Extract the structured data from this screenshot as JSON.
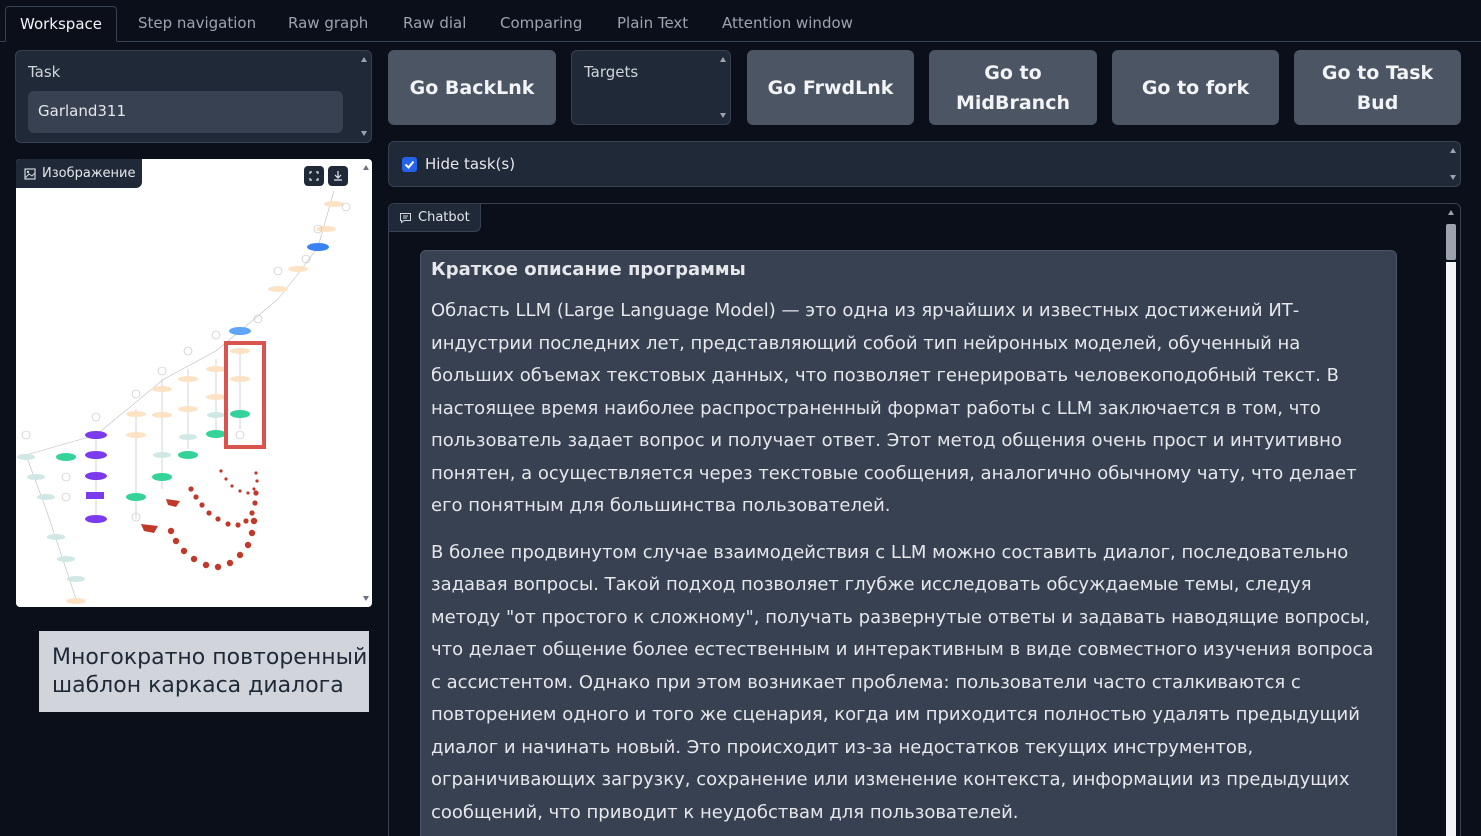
{
  "tabs": [
    "Workspace",
    "Step navigation",
    "Raw graph",
    "Raw dial",
    "Comparing",
    "Plain Text",
    "Attention window"
  ],
  "task": {
    "label": "Task",
    "value": "Garland311"
  },
  "image_panel": {
    "label": "Изображение"
  },
  "buttons": {
    "back": "Go BackLnk",
    "forward": "Go FrwdLnk",
    "midbranch": "Go to MidBranch",
    "fork": "Go to fork",
    "task_bud": "Go to Task Bud"
  },
  "targets": {
    "label": "Targets"
  },
  "hide_tasks": {
    "label": "Hide task(s)",
    "checked": true
  },
  "chatbot": {
    "label": "Chatbot",
    "heading": "Краткое описание программы",
    "paragraphs": [
      "Область LLM (Large Language Model) — это одна из ярчайших и известных достижений ИТ-индустрии последних лет, представляющий собой тип нейронных моделей, обученный на больших объемах текстовых данных, что позволяет генерировать человекоподобный текст. В настоящее время наиболее распространенный формат работы с LLM заключается в том, что пользователь задает вопрос и получает ответ. Этот метод общения очень прост и интуитивно понятен, а осуществляется через текстовые сообщения, аналогично обычному чату, что делает его понятным для большинства пользователей.",
      "В более продвинутом случае взаимодействия с LLM можно составить диалог, последовательно задавая вопросы. Такой подход позволяет глубже исследовать обсуждаемые темы, следуя методу \"от простого к сложному\", получать развернутые ответы и задавать наводящие вопросы, что делает общение более естественным и интерактивным в виде совместного изучения вопроса с ассистентом. Однако при этом возникает проблема: пользователи часто сталкиваются с повторением одного и того же сценария, когда им приходится полностью удалять предыдущий диалог и начинать новый. Это происходит из-за недостатков текущих инструментов, ограничивающих загрузку, сохранение или изменение контекста, информации из предыдущих сообщений, что приводит к неудобствам для пользователей."
    ]
  },
  "caption": "Многократно повторенный шаблон каркаса диалога",
  "colors": {
    "highlight_box": "#d9534f",
    "accent_blue": "#2563eb"
  }
}
